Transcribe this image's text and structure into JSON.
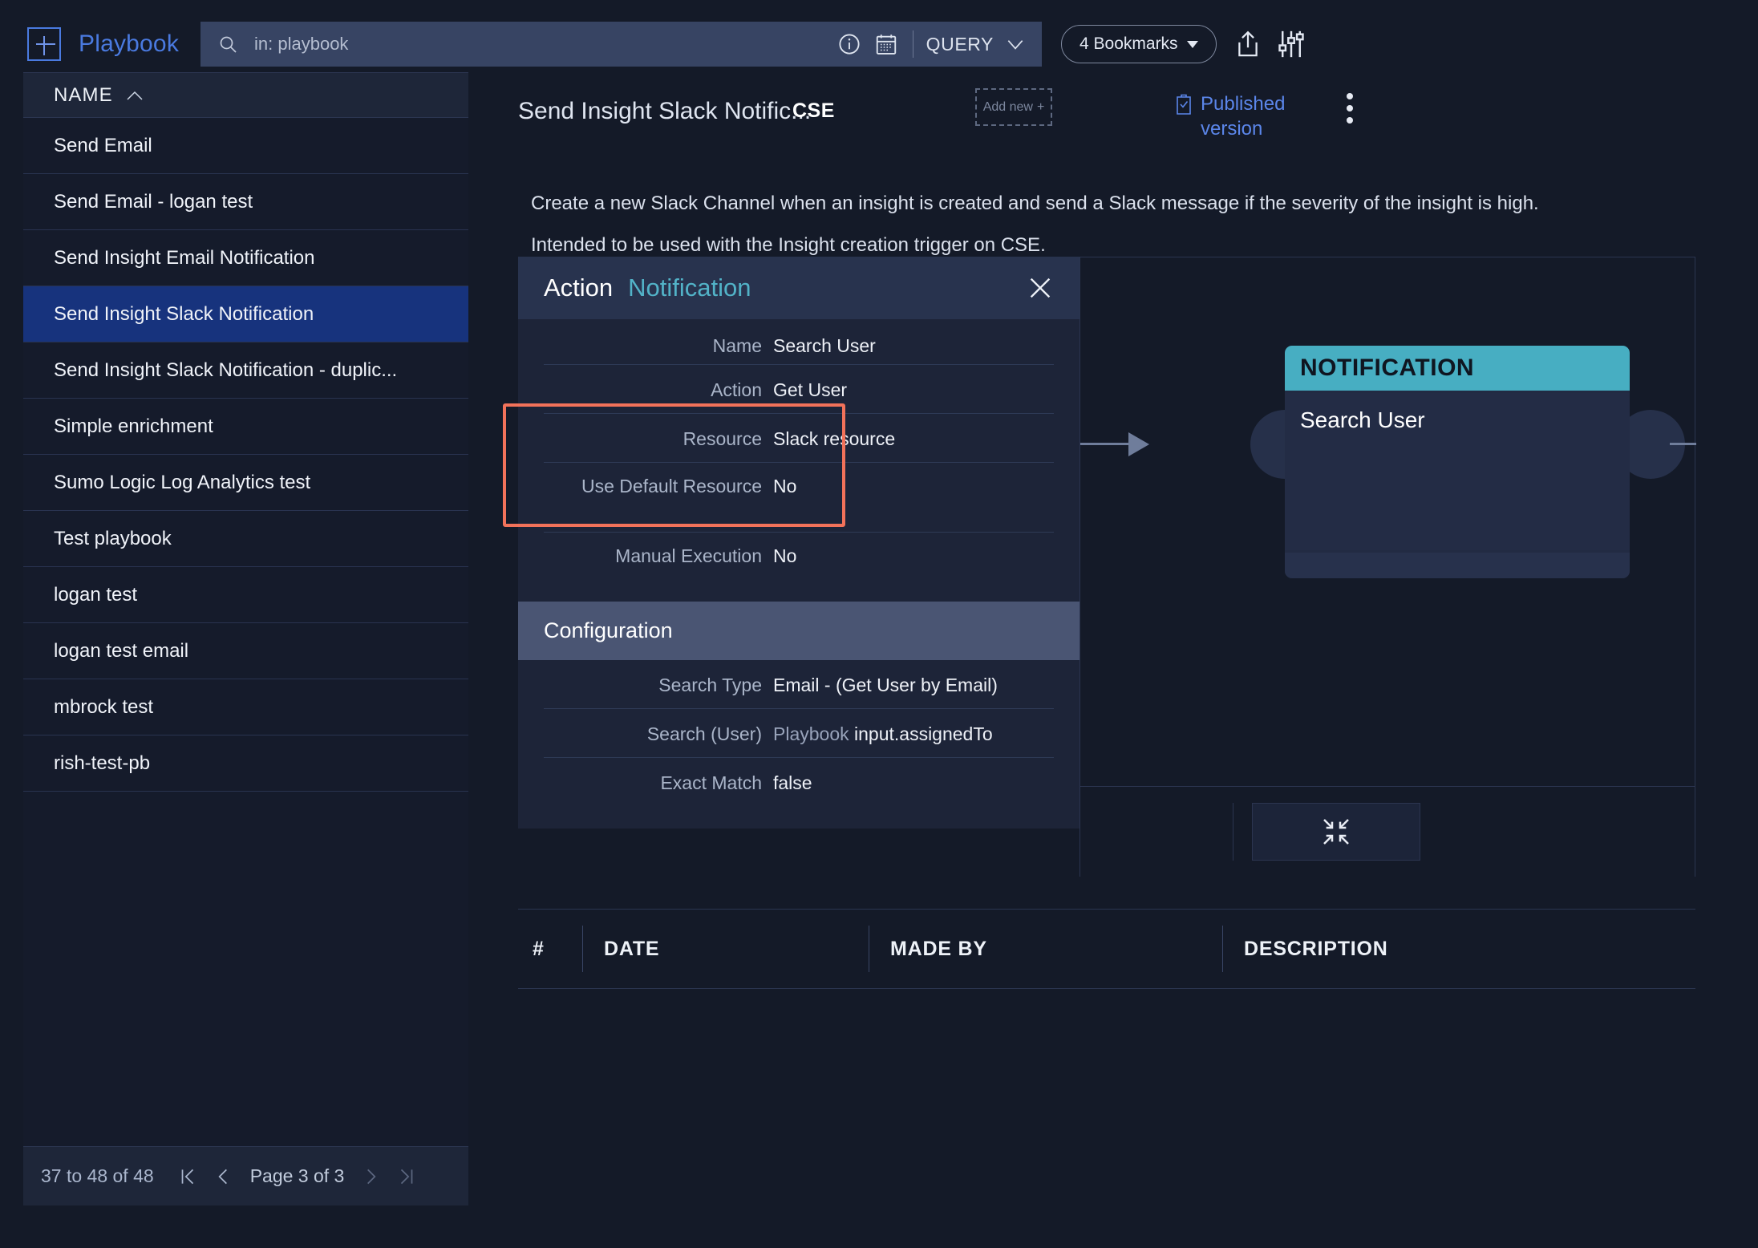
{
  "topbar": {
    "new_label": "+",
    "brand": "Playbook",
    "search_placeholder": "in: playbook",
    "search_value": "",
    "query_label": "QUERY",
    "bookmarks_label": "4 Bookmarks"
  },
  "sidebar": {
    "header": "NAME",
    "items": [
      {
        "label": "Send Email",
        "selected": false
      },
      {
        "label": "Send Email - logan test",
        "selected": false
      },
      {
        "label": "Send Insight Email Notification",
        "selected": false
      },
      {
        "label": "Send Insight Slack Notification",
        "selected": true
      },
      {
        "label": "Send Insight Slack Notification - duplic...",
        "selected": false
      },
      {
        "label": "Simple enrichment",
        "selected": false
      },
      {
        "label": "Sumo Logic Log Analytics test",
        "selected": false
      },
      {
        "label": "Test playbook",
        "selected": false
      },
      {
        "label": "logan test",
        "selected": false
      },
      {
        "label": "logan test email",
        "selected": false
      },
      {
        "label": "mbrock test",
        "selected": false
      },
      {
        "label": "rish-test-pb",
        "selected": false
      }
    ],
    "footer": {
      "range": "37 to 48 of 48",
      "page": "Page 3 of 3"
    }
  },
  "document": {
    "title": "Send Insight Slack Notific...",
    "tag": "CSE",
    "add_new": "Add new",
    "add_new_plus": "+",
    "status": "Published version",
    "description_line1": "Create a new Slack Channel when an insight is created and send a Slack message if the severity of the insight is high.",
    "description_line2": "Intended to be used with the Insight creation trigger on CSE."
  },
  "action_panel": {
    "title": "Action",
    "subtitle": "Notification",
    "fields": [
      {
        "key": "Name",
        "value": "Search User"
      },
      {
        "key": "Action",
        "value": "Get User"
      },
      {
        "key": "Resource",
        "value": "Slack resource"
      },
      {
        "key": "Use Default Resource",
        "value": "No"
      },
      {
        "key": "Manual Execution",
        "value": "No"
      }
    ],
    "configuration": {
      "header": "Configuration",
      "fields": [
        {
          "key": "Search Type",
          "value": "Email - (Get User by Email)",
          "prefix": ""
        },
        {
          "key": "Search (User)",
          "value": "input.assignedTo",
          "prefix": "Playbook"
        },
        {
          "key": "Exact Match",
          "value": "false",
          "prefix": ""
        }
      ]
    }
  },
  "canvas": {
    "node": {
      "type": "NOTIFICATION",
      "name": "Search User"
    }
  },
  "bottom_table": {
    "columns": [
      "#",
      "DATE",
      "MADE BY",
      "DESCRIPTION"
    ]
  },
  "colors": {
    "accent_blue": "#4a7ae0",
    "highlight_red": "#f2725a",
    "node_teal": "#47aec2",
    "selected_row": "#17337d"
  }
}
